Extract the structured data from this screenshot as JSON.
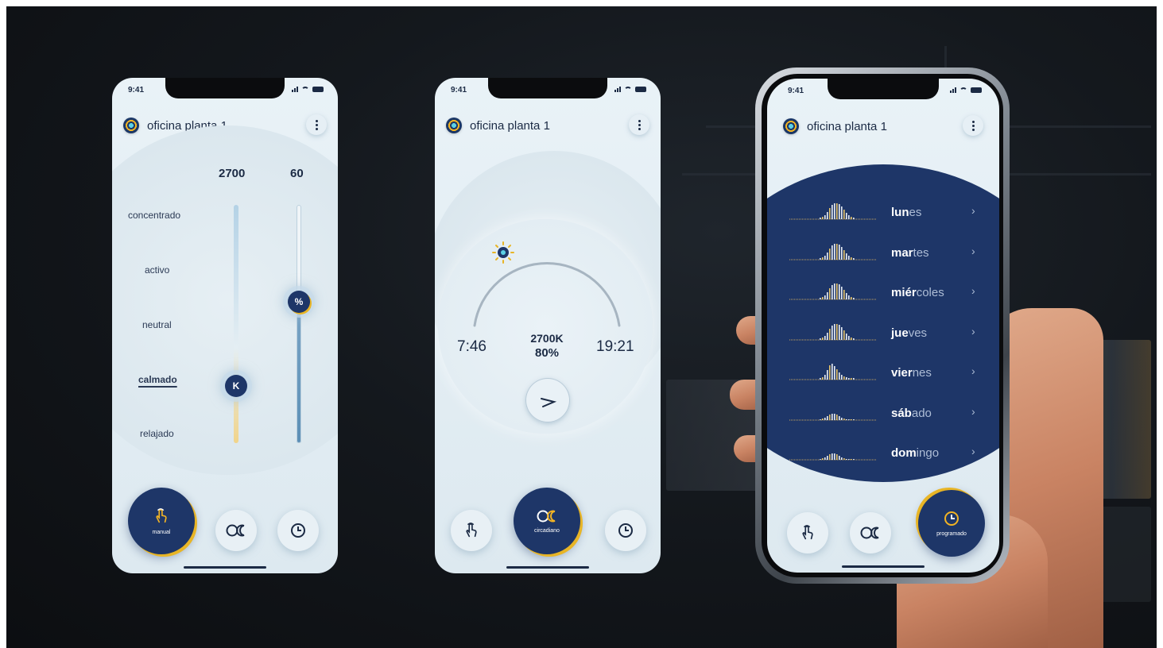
{
  "status": {
    "time": "9:41"
  },
  "header": {
    "location": "oficina planta 1"
  },
  "manual": {
    "kelvin_value": "2700",
    "percent_value": "60",
    "moods": [
      "concentrado",
      "activo",
      "neutral",
      "calmado",
      "relajado"
    ],
    "selected_mood": "calmado",
    "kelvin_knob_label": "K",
    "percent_knob_label": "%",
    "percent_level": 0.6
  },
  "circadian": {
    "sunrise": "7:46",
    "sunset": "19:21",
    "temperature": "2700K",
    "brightness": "80%"
  },
  "schedule": {
    "days": [
      {
        "bold": "lun",
        "rest": "es"
      },
      {
        "bold": "mar",
        "rest": "tes"
      },
      {
        "bold": "miér",
        "rest": "coles"
      },
      {
        "bold": "jue",
        "rest": "ves"
      },
      {
        "bold": "vier",
        "rest": "nes"
      },
      {
        "bold": "sáb",
        "rest": "ado"
      },
      {
        "bold": "dom",
        "rest": "ingo"
      }
    ]
  },
  "nav": {
    "manual_label": "manual",
    "circadian_label": "circadiano",
    "programmed_label": "programado"
  },
  "colors": {
    "navy": "#1e3668",
    "accent_yellow": "#e8b526",
    "background": "#e9f2f7"
  }
}
